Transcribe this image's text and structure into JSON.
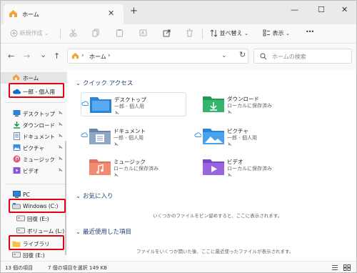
{
  "tab": {
    "title": "ホーム",
    "close_glyph": "✕",
    "new_tab_glyph": "+"
  },
  "window_controls": {
    "minimize": "—",
    "maximize": "☐",
    "close": "✕"
  },
  "toolbar": {
    "new_label": "新規作成",
    "sort_label": "並べ替え",
    "view_label": "表示",
    "more_glyph": "•••"
  },
  "nav": {
    "back": "←",
    "forward": "→",
    "dropdown": "⌄",
    "up": "↑"
  },
  "address": {
    "crumb": "ホーム",
    "sep": "›",
    "drop": "⌄",
    "refresh": "↻"
  },
  "search": {
    "placeholder": "ホームの検索"
  },
  "sidebar": {
    "home": "ホーム",
    "onedrive": "一郎 - 個人用",
    "desktop": "デスクトップ",
    "downloads": "ダウンロード",
    "documents": "ドキュメント",
    "pictures": "ピクチャ",
    "music": "ミュージック",
    "videos": "ビデオ",
    "pc": "PC",
    "windows_c": "Windows (C:)",
    "drive_e": "回復 (E:)",
    "drive_l": "ボリューム (L:)",
    "library": "ライブラリ",
    "drive_e2": "回復 (E:)"
  },
  "quick_access": {
    "header": "クイック アクセス",
    "items": [
      {
        "name": "デスクトップ",
        "sub": "一郎 - 個人用"
      },
      {
        "name": "ダウンロード",
        "sub": "ローカルに保存済み"
      },
      {
        "name": "ドキュメント",
        "sub": "一郎 - 個人用"
      },
      {
        "name": "ピクチャ",
        "sub": "一郎 - 個人用"
      },
      {
        "name": "ミュージック",
        "sub": "ローカルに保存済み"
      },
      {
        "name": "ビデオ",
        "sub": "ローカルに保存済み"
      }
    ]
  },
  "favorites": {
    "header": "お気に入り",
    "empty": "いくつかのファイルをピン留めすると、ここに表示されます。"
  },
  "recent": {
    "header": "最近使用した項目",
    "empty": "ファイルをいくつか開いた後、ここに最近使ったファイルが表示されます。"
  },
  "status": {
    "count": "13 個の項目",
    "selection": "7 個の項目を選択  149 KB"
  },
  "colors": {
    "highlight": "#e60012",
    "accent": "#0067c0"
  }
}
